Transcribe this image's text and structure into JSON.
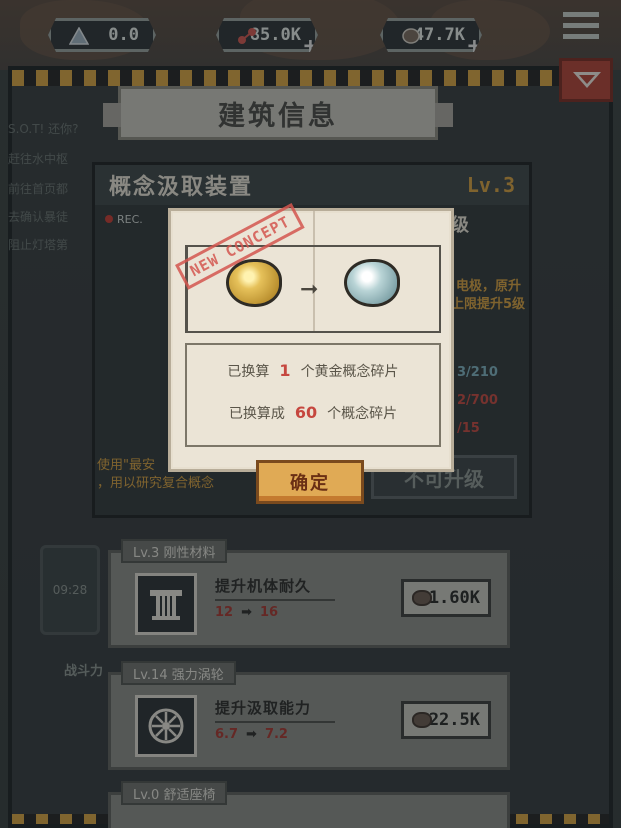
{
  "resources": [
    {
      "name": "triangle-resource",
      "value": "0.0",
      "has_plus": false
    },
    {
      "name": "molecule-resource",
      "value": "85.0K",
      "has_plus": true
    },
    {
      "name": "ore-resource",
      "value": "47.7K",
      "has_plus": true
    }
  ],
  "header": {
    "title": "建筑信息"
  },
  "quests": [
    "S.O.T! 还你?",
    "赶往水中枢",
    "前往首页都",
    "去确认暴徒",
    "阻止灯塔第"
  ],
  "building": {
    "name": "概念汲取装置",
    "level": "Lv.3",
    "rec": "REC.",
    "side_right_top": "升级",
    "side_desc_1": "电极，原升",
    "side_desc_2": "上限提升5级",
    "stat_1": "3/210",
    "stat_2": "2/700",
    "stat_3": "/15",
    "usage_1": "使用\"最安",
    "usage_2": "，用以研究复合概念",
    "upgrade_button": "不可升级"
  },
  "dialog": {
    "stamp": "NEW CONCEPT",
    "line1_prefix": "已换算",
    "line1_num": "1",
    "line1_suffix": "个黄金概念碎片",
    "line2_prefix": "已换算成",
    "line2_num": "60",
    "line2_suffix": "个概念碎片",
    "confirm": "确定"
  },
  "upgrades": [
    {
      "tag": "Lv.3 刚性材料",
      "desc": "提升机体耐久",
      "from": "12",
      "to": "16",
      "cost": "1.60K",
      "icon": "pillar-icon"
    },
    {
      "tag": "Lv.14 强力涡轮",
      "desc": "提升汲取能力",
      "from": "6.7",
      "to": "7.2",
      "cost": "22.5K",
      "icon": "turbine-icon"
    },
    {
      "tag": "Lv.0 舒适座椅"
    }
  ],
  "side_left": {
    "time": "09:28",
    "power": "战斗力"
  }
}
